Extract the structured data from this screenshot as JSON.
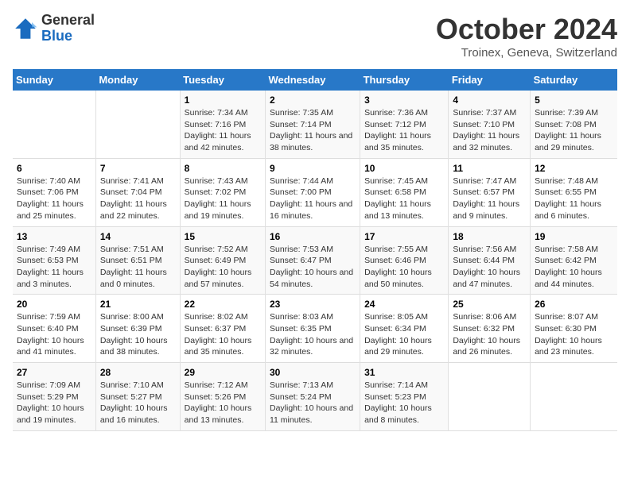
{
  "header": {
    "logo_general": "General",
    "logo_blue": "Blue",
    "month_title": "October 2024",
    "location": "Troinex, Geneva, Switzerland"
  },
  "weekdays": [
    "Sunday",
    "Monday",
    "Tuesday",
    "Wednesday",
    "Thursday",
    "Friday",
    "Saturday"
  ],
  "weeks": [
    [
      {
        "day": "",
        "sunrise": "",
        "sunset": "",
        "daylight": ""
      },
      {
        "day": "",
        "sunrise": "",
        "sunset": "",
        "daylight": ""
      },
      {
        "day": "1",
        "sunrise": "Sunrise: 7:34 AM",
        "sunset": "Sunset: 7:16 PM",
        "daylight": "Daylight: 11 hours and 42 minutes."
      },
      {
        "day": "2",
        "sunrise": "Sunrise: 7:35 AM",
        "sunset": "Sunset: 7:14 PM",
        "daylight": "Daylight: 11 hours and 38 minutes."
      },
      {
        "day": "3",
        "sunrise": "Sunrise: 7:36 AM",
        "sunset": "Sunset: 7:12 PM",
        "daylight": "Daylight: 11 hours and 35 minutes."
      },
      {
        "day": "4",
        "sunrise": "Sunrise: 7:37 AM",
        "sunset": "Sunset: 7:10 PM",
        "daylight": "Daylight: 11 hours and 32 minutes."
      },
      {
        "day": "5",
        "sunrise": "Sunrise: 7:39 AM",
        "sunset": "Sunset: 7:08 PM",
        "daylight": "Daylight: 11 hours and 29 minutes."
      }
    ],
    [
      {
        "day": "6",
        "sunrise": "Sunrise: 7:40 AM",
        "sunset": "Sunset: 7:06 PM",
        "daylight": "Daylight: 11 hours and 25 minutes."
      },
      {
        "day": "7",
        "sunrise": "Sunrise: 7:41 AM",
        "sunset": "Sunset: 7:04 PM",
        "daylight": "Daylight: 11 hours and 22 minutes."
      },
      {
        "day": "8",
        "sunrise": "Sunrise: 7:43 AM",
        "sunset": "Sunset: 7:02 PM",
        "daylight": "Daylight: 11 hours and 19 minutes."
      },
      {
        "day": "9",
        "sunrise": "Sunrise: 7:44 AM",
        "sunset": "Sunset: 7:00 PM",
        "daylight": "Daylight: 11 hours and 16 minutes."
      },
      {
        "day": "10",
        "sunrise": "Sunrise: 7:45 AM",
        "sunset": "Sunset: 6:58 PM",
        "daylight": "Daylight: 11 hours and 13 minutes."
      },
      {
        "day": "11",
        "sunrise": "Sunrise: 7:47 AM",
        "sunset": "Sunset: 6:57 PM",
        "daylight": "Daylight: 11 hours and 9 minutes."
      },
      {
        "day": "12",
        "sunrise": "Sunrise: 7:48 AM",
        "sunset": "Sunset: 6:55 PM",
        "daylight": "Daylight: 11 hours and 6 minutes."
      }
    ],
    [
      {
        "day": "13",
        "sunrise": "Sunrise: 7:49 AM",
        "sunset": "Sunset: 6:53 PM",
        "daylight": "Daylight: 11 hours and 3 minutes."
      },
      {
        "day": "14",
        "sunrise": "Sunrise: 7:51 AM",
        "sunset": "Sunset: 6:51 PM",
        "daylight": "Daylight: 11 hours and 0 minutes."
      },
      {
        "day": "15",
        "sunrise": "Sunrise: 7:52 AM",
        "sunset": "Sunset: 6:49 PM",
        "daylight": "Daylight: 10 hours and 57 minutes."
      },
      {
        "day": "16",
        "sunrise": "Sunrise: 7:53 AM",
        "sunset": "Sunset: 6:47 PM",
        "daylight": "Daylight: 10 hours and 54 minutes."
      },
      {
        "day": "17",
        "sunrise": "Sunrise: 7:55 AM",
        "sunset": "Sunset: 6:46 PM",
        "daylight": "Daylight: 10 hours and 50 minutes."
      },
      {
        "day": "18",
        "sunrise": "Sunrise: 7:56 AM",
        "sunset": "Sunset: 6:44 PM",
        "daylight": "Daylight: 10 hours and 47 minutes."
      },
      {
        "day": "19",
        "sunrise": "Sunrise: 7:58 AM",
        "sunset": "Sunset: 6:42 PM",
        "daylight": "Daylight: 10 hours and 44 minutes."
      }
    ],
    [
      {
        "day": "20",
        "sunrise": "Sunrise: 7:59 AM",
        "sunset": "Sunset: 6:40 PM",
        "daylight": "Daylight: 10 hours and 41 minutes."
      },
      {
        "day": "21",
        "sunrise": "Sunrise: 8:00 AM",
        "sunset": "Sunset: 6:39 PM",
        "daylight": "Daylight: 10 hours and 38 minutes."
      },
      {
        "day": "22",
        "sunrise": "Sunrise: 8:02 AM",
        "sunset": "Sunset: 6:37 PM",
        "daylight": "Daylight: 10 hours and 35 minutes."
      },
      {
        "day": "23",
        "sunrise": "Sunrise: 8:03 AM",
        "sunset": "Sunset: 6:35 PM",
        "daylight": "Daylight: 10 hours and 32 minutes."
      },
      {
        "day": "24",
        "sunrise": "Sunrise: 8:05 AM",
        "sunset": "Sunset: 6:34 PM",
        "daylight": "Daylight: 10 hours and 29 minutes."
      },
      {
        "day": "25",
        "sunrise": "Sunrise: 8:06 AM",
        "sunset": "Sunset: 6:32 PM",
        "daylight": "Daylight: 10 hours and 26 minutes."
      },
      {
        "day": "26",
        "sunrise": "Sunrise: 8:07 AM",
        "sunset": "Sunset: 6:30 PM",
        "daylight": "Daylight: 10 hours and 23 minutes."
      }
    ],
    [
      {
        "day": "27",
        "sunrise": "Sunrise: 7:09 AM",
        "sunset": "Sunset: 5:29 PM",
        "daylight": "Daylight: 10 hours and 19 minutes."
      },
      {
        "day": "28",
        "sunrise": "Sunrise: 7:10 AM",
        "sunset": "Sunset: 5:27 PM",
        "daylight": "Daylight: 10 hours and 16 minutes."
      },
      {
        "day": "29",
        "sunrise": "Sunrise: 7:12 AM",
        "sunset": "Sunset: 5:26 PM",
        "daylight": "Daylight: 10 hours and 13 minutes."
      },
      {
        "day": "30",
        "sunrise": "Sunrise: 7:13 AM",
        "sunset": "Sunset: 5:24 PM",
        "daylight": "Daylight: 10 hours and 11 minutes."
      },
      {
        "day": "31",
        "sunrise": "Sunrise: 7:14 AM",
        "sunset": "Sunset: 5:23 PM",
        "daylight": "Daylight: 10 hours and 8 minutes."
      },
      {
        "day": "",
        "sunrise": "",
        "sunset": "",
        "daylight": ""
      },
      {
        "day": "",
        "sunrise": "",
        "sunset": "",
        "daylight": ""
      }
    ]
  ]
}
